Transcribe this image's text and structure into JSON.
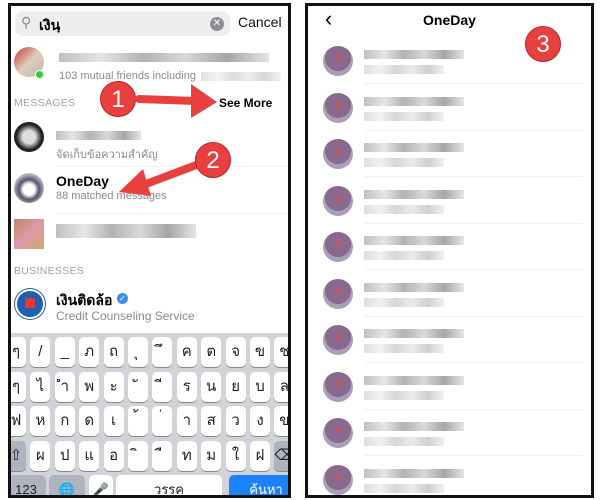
{
  "search": {
    "query": "เงินฺ",
    "cancel_label": "Cancel",
    "search_icon": "search-icon",
    "clear_icon": "clear-icon"
  },
  "people": [
    {
      "subtitle": "103 mutual friends including"
    }
  ],
  "messages": {
    "header": "MESSAGES",
    "see_more": "See More",
    "items": [
      {
        "subtitle": "จัดเก็บข้อความสำคัญ"
      },
      {
        "name": "OneDay",
        "subtitle": "88 matched messages"
      }
    ]
  },
  "businesses": {
    "header": "BUSINESSES",
    "items": [
      {
        "name": "เงินติดล้อ",
        "verified": true,
        "subtitle": "Credit Counseling Service"
      }
    ]
  },
  "keyboard": {
    "rows": [
      [
        "ๆ",
        "/",
        "_",
        "ภ",
        "ถ",
        "ุ",
        "ึ",
        "ค",
        "ต",
        "จ",
        "ข",
        "ช"
      ],
      [
        "ๆ",
        "ไ",
        "ำ",
        "พ",
        "ะ",
        "ั",
        "ี",
        "ร",
        "น",
        "ย",
        "บ",
        "ล"
      ],
      [
        "ฟ",
        "ห",
        "ก",
        "ด",
        "เ",
        "้",
        "่",
        "า",
        "ส",
        "ว",
        "ง",
        "ข"
      ],
      [
        "⇧",
        "ผ",
        "ป",
        "แ",
        "อ",
        "ิ",
        "ื",
        "ท",
        "ม",
        "ใ",
        "ฝ",
        "⌫"
      ]
    ],
    "numbers": "123",
    "space": "วรรค",
    "search": "ค้นหา",
    "accent": "#1a82fb"
  },
  "detail": {
    "title": "OneDay",
    "back_icon": "chevron-left-icon",
    "row_count": 10
  },
  "annotations": {
    "step1": "1",
    "step2": "2",
    "step3": "3",
    "color": "#e8403f"
  }
}
